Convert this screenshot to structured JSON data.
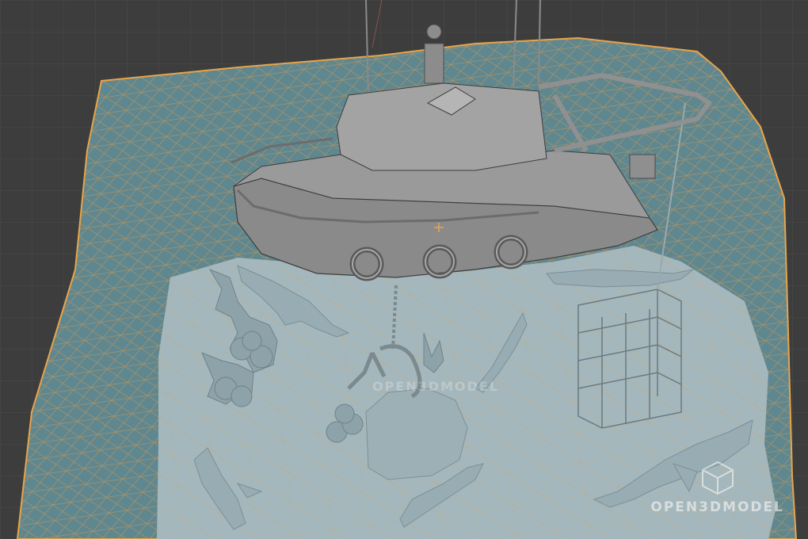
{
  "viewport": {
    "mode": "3D Viewport - Wireframe Overlay",
    "background_color": "#3d3d3d",
    "ocean_color": "#5f8790",
    "ocean_edge_color": "#e8a54a",
    "seabed_color": "#9fb3b8"
  },
  "scene": {
    "objects": [
      "boat-icon",
      "ocean-plane-icon",
      "seabed-icon",
      "shark-icon",
      "shark-cage-icon",
      "anchor-icon",
      "coral-icon",
      "rock-icon",
      "lifebuoy-icon"
    ]
  },
  "watermark": {
    "brand": "OPEN3DMODEL",
    "center_brand": "OPEN3DMODEL"
  }
}
